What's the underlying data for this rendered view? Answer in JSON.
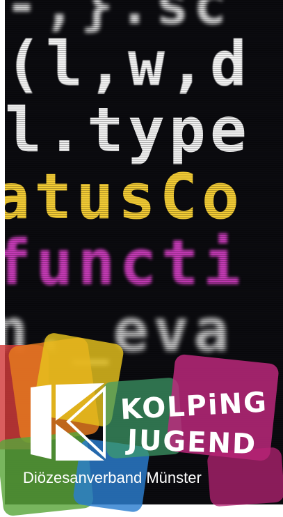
{
  "code_lines": [
    "-,}.sc",
    "(l,w,d",
    "l.type",
    "atusCo",
    "functi",
    "n._eva"
  ],
  "brand": {
    "line1": "KOLPiNG",
    "line2": "JUGEND",
    "subtitle": "Diözesanverband Münster"
  },
  "colors": {
    "code_yellow": "#f3cc35",
    "code_magenta": "#c43ab5",
    "shape_red": "#d23a3a",
    "shape_orange": "#e77b1f",
    "shape_yellow": "#e6c21d",
    "shape_green": "#5aa63a",
    "shape_magenta": "#c1287f",
    "shape_blue": "#2b7ecf"
  }
}
